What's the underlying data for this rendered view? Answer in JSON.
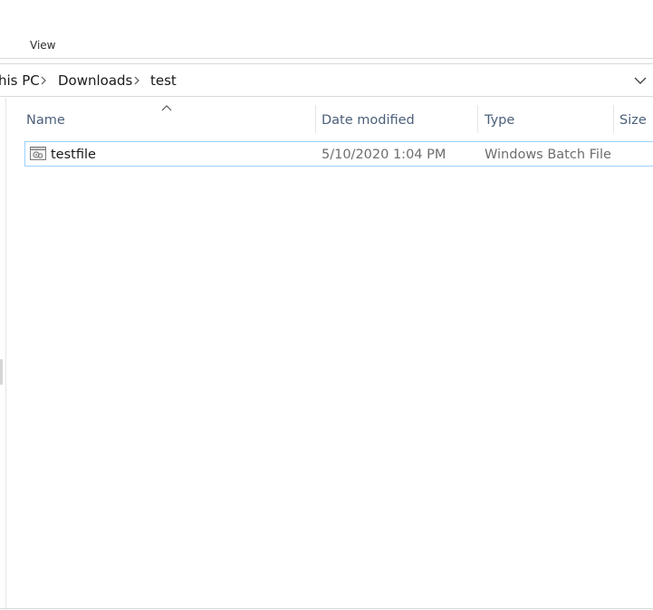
{
  "ribbon": {
    "tabs": [
      {
        "label": "View"
      }
    ]
  },
  "address_bar": {
    "breadcrumbs": [
      {
        "label": "his PC"
      },
      {
        "label": "Downloads"
      },
      {
        "label": "test"
      }
    ]
  },
  "file_list": {
    "columns": [
      {
        "label": "Name"
      },
      {
        "label": "Date modified"
      },
      {
        "label": "Type"
      },
      {
        "label": "Size"
      }
    ],
    "sort_column": "Name",
    "rows": [
      {
        "name": "testfile",
        "date_modified": "5/10/2020 1:04 PM",
        "type": "Windows Batch File",
        "size": "",
        "icon": "batch-file-icon"
      }
    ]
  },
  "colors": {
    "header_text": "#4c607a",
    "selection_border": "#99d1ff",
    "secondary_text": "#6d6d6d"
  }
}
